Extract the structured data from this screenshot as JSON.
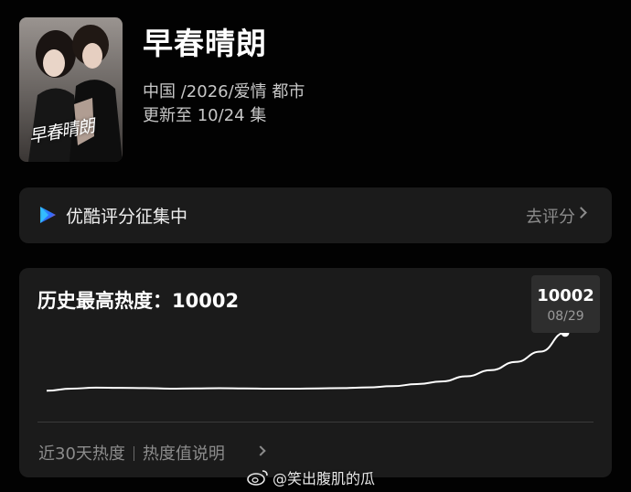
{
  "show": {
    "title": "早春晴朗",
    "meta_line": "中国 /2026/爱情 都市",
    "update_line": "更新至 10/24 集",
    "poster_logo": "早春晴朗"
  },
  "rating": {
    "label": "优酷评分征集中",
    "link": "去评分",
    "icon": "youku-icon"
  },
  "heat": {
    "title": "历史最高热度：10002",
    "tooltip_value": "10002",
    "tooltip_date": "08/29",
    "footer_left": "近30天热度",
    "footer_right": "热度值说明",
    "line_color": "#ffffff"
  },
  "chart_data": {
    "type": "line",
    "series": [
      {
        "values": [
          9720,
          9730,
          9735,
          9734,
          9733,
          9730,
          9731,
          9732,
          9731,
          9730,
          9730,
          9731,
          9733,
          9736,
          9742,
          9752,
          9765,
          9790,
          9820,
          9860,
          9910,
          10002
        ]
      }
    ],
    "ylim": [
      9650,
      10050
    ],
    "highlight": {
      "value": 10002,
      "label": "08/29"
    },
    "grid": false
  },
  "watermark": {
    "text": "@笑出腹肌的瓜",
    "icon": "weibo-icon"
  }
}
